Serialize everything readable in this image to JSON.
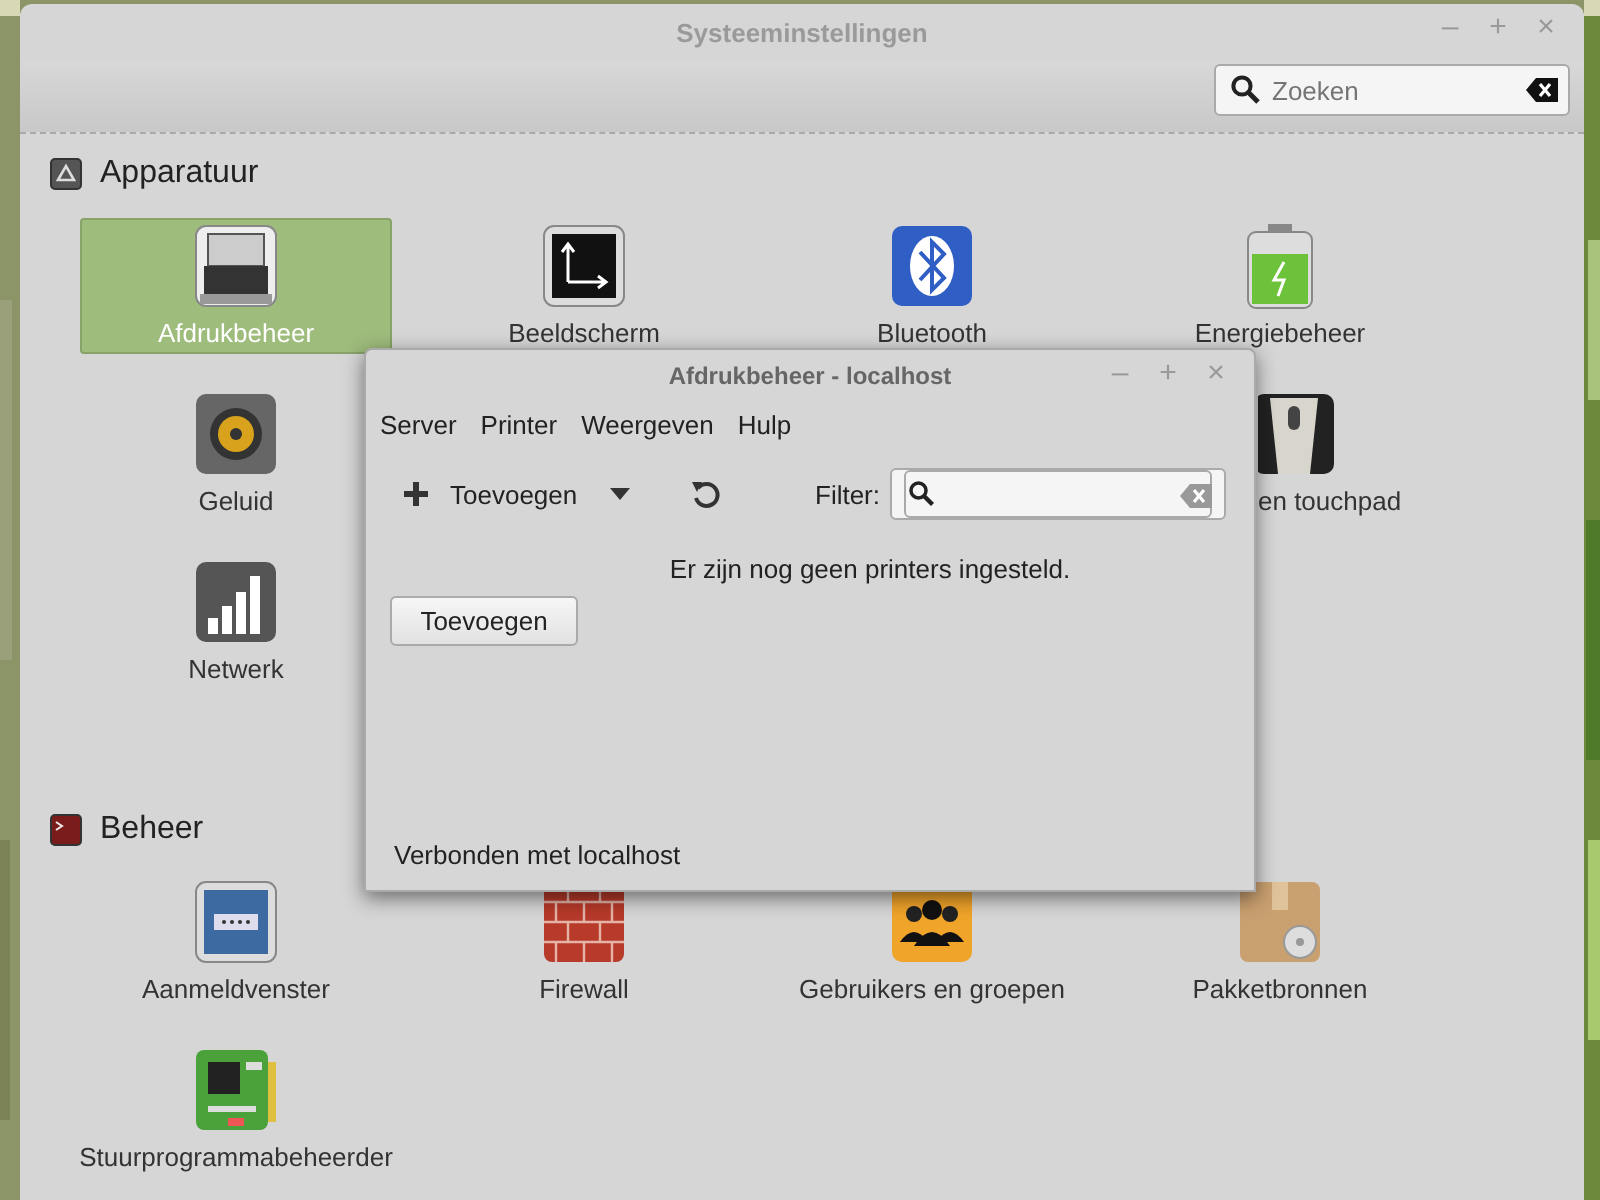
{
  "window": {
    "title": "Systeeminstellingen",
    "controls": [
      "–",
      "+",
      "×"
    ]
  },
  "search": {
    "placeholder": "Zoeken"
  },
  "sections": [
    {
      "title": "Apparatuur",
      "items": [
        {
          "label": "Afdrukbeheer",
          "selected": true
        },
        {
          "label": "Beeldscherm",
          "selected": false
        },
        {
          "label": "Bluetooth",
          "selected": false
        },
        {
          "label": "Energiebeheer",
          "selected": false
        },
        {
          "label": "Geluid",
          "selected": false
        },
        {
          "label": "en touchpad",
          "selected": false
        },
        {
          "label": "Netwerk",
          "selected": false
        }
      ]
    },
    {
      "title": "Beheer",
      "items": [
        {
          "label": "Aanmeldvenster",
          "selected": false
        },
        {
          "label": "Firewall",
          "selected": false
        },
        {
          "label": "Gebruikers en groepen",
          "selected": false
        },
        {
          "label": "Pakketbronnen",
          "selected": false
        },
        {
          "label": "Stuurprogrammabeheerder",
          "selected": false
        }
      ]
    }
  ],
  "dialog": {
    "title": "Afdrukbeheer - localhost",
    "controls": [
      "–",
      "+",
      "×"
    ],
    "menu": [
      "Server",
      "Printer",
      "Weergeven",
      "Hulp"
    ],
    "add_label": "Toevoegen",
    "filter_label": "Filter:",
    "message": "Er zijn nog geen printers ingesteld.",
    "button": "Toevoegen",
    "status": "Verbonden met localhost"
  }
}
